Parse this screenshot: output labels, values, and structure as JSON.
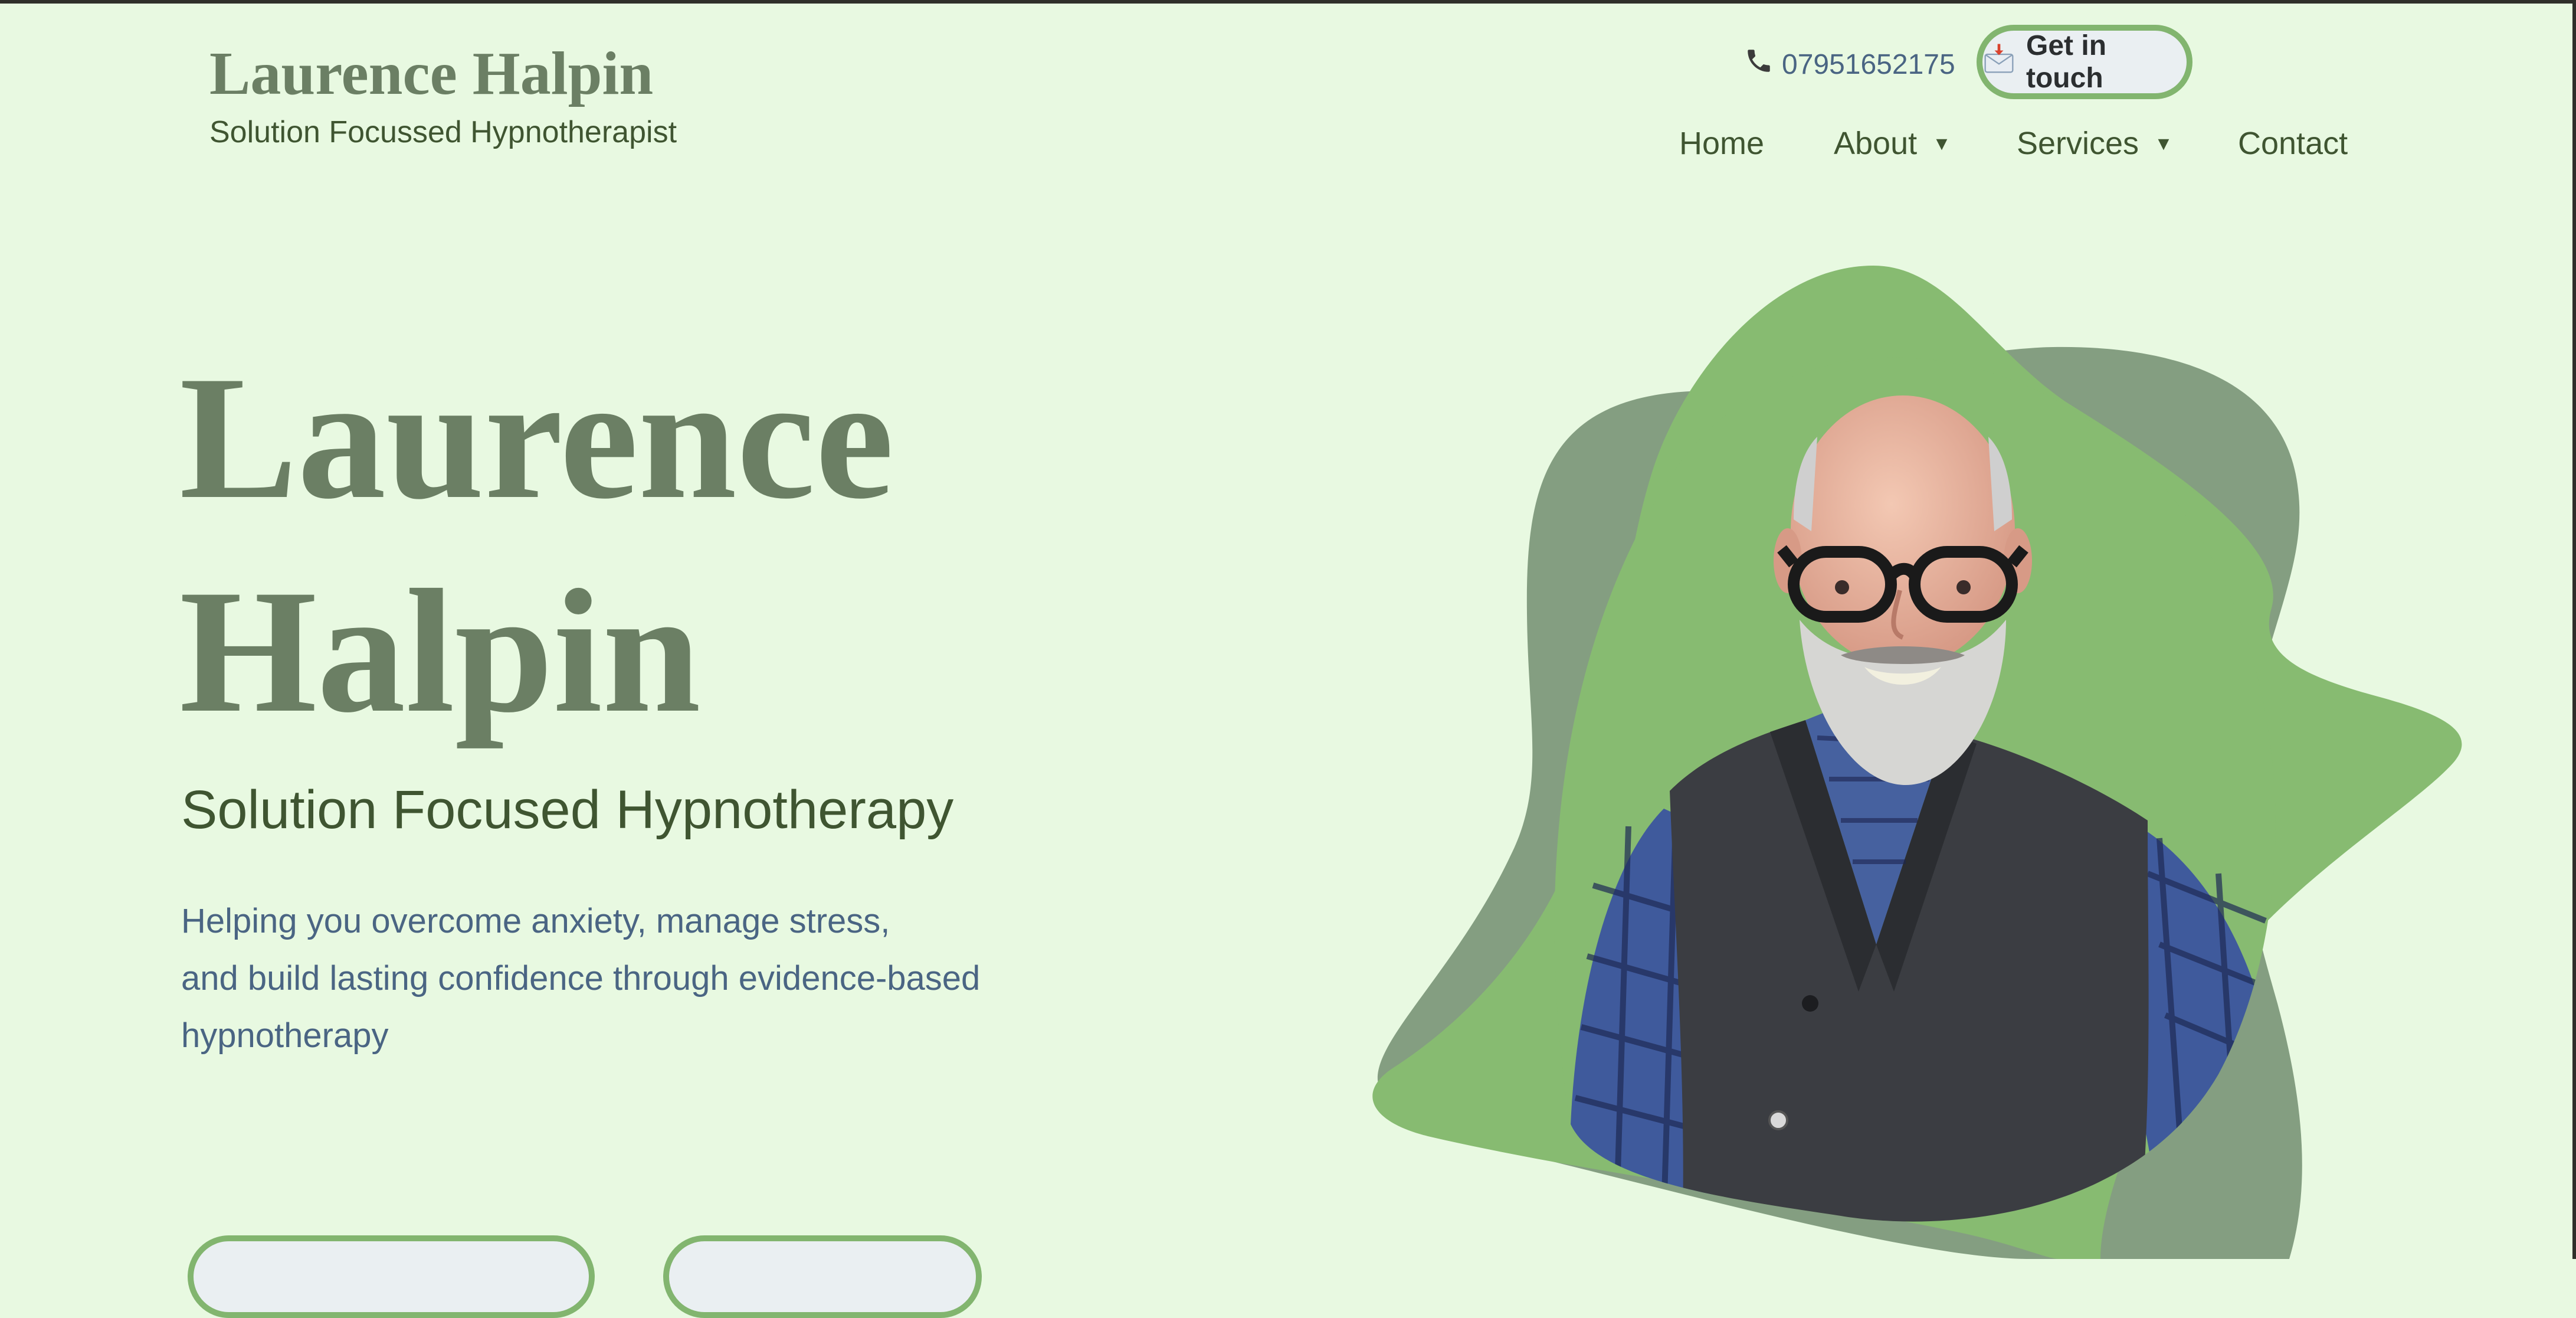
{
  "header": {
    "brand_name": "Laurence Halpin",
    "brand_tagline": "Solution Focussed Hypnotherapist",
    "phone_icon": "phone-icon",
    "phone": "07951652175",
    "cta_icon": "envelope-icon",
    "cta_label": "Get in touch"
  },
  "nav": {
    "items": [
      {
        "label": "Home",
        "has_dropdown": false
      },
      {
        "label": "About",
        "has_dropdown": true,
        "caret": "▼"
      },
      {
        "label": "Services",
        "has_dropdown": true,
        "caret": "▼"
      },
      {
        "label": "Contact",
        "has_dropdown": false
      }
    ]
  },
  "hero": {
    "name_line1": "Laurence",
    "name_line2": "Halpin",
    "subtitle": "Solution Focused Hypnotherapy",
    "desc_line1": "Helping you overcome anxiety, manage stress,",
    "desc_line2": "and build lasting confidence through evidence-based",
    "desc_line3": "hypnotherapy",
    "buttons": [
      "",
      ""
    ]
  },
  "colors": {
    "background": "#e8f9e1",
    "heading": "#6b7f64",
    "text_dark_green": "#3f5531",
    "text_blue": "#4a6583",
    "accent_green": "#82b56f",
    "blob_grey_green": "#849e81",
    "button_bg": "#eaeff2"
  }
}
